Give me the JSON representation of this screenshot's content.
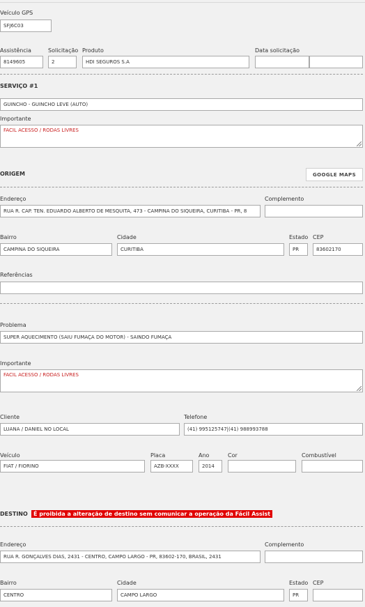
{
  "vehicle_gps": {
    "label": "Veículo GPS",
    "value": "SFJ6C03"
  },
  "request": {
    "assistencia": {
      "label": "Assistência",
      "value": "8149605"
    },
    "solicitacao": {
      "label": "Solicitação",
      "value": "2"
    },
    "produto": {
      "label": "Produto",
      "value": "HDI SEGUROS S.A"
    },
    "data_solicitacao": {
      "label": "Data solicitação",
      "value": "",
      "value2": ""
    }
  },
  "servico": {
    "title": "SERVIÇO #1",
    "value": "GUINCHO - GUINCHO LEVE (AUTO)",
    "importante_label": "Importante",
    "importante_value": "FACIL ACESSO / RODAS LIVRES"
  },
  "origem": {
    "title": "ORIGEM",
    "maps_button": "GOOGLE MAPS",
    "endereco_label": "Endereço",
    "endereco_value": "RUA R. CAP. TEN. EDUARDO ALBERTO DE MESQUITA, 473 - CAMPINA DO SIQUEIRA, CURITIBA - PR, 8",
    "complemento_label": "Complemento",
    "complemento_value": "",
    "bairro_label": "Bairro",
    "bairro_value": "CAMPINA DO SIQUEIRA",
    "cidade_label": "Cidade",
    "cidade_value": "CURITIBA",
    "estado_label": "Estado",
    "estado_value": "PR",
    "cep_label": "CEP",
    "cep_value": "83602170",
    "referencias_label": "Referências",
    "referencias_value": ""
  },
  "problema": {
    "label": "Problema",
    "value": "SUPER AQUECIMENTO (SAIU FUMAÇA DO MOTOR) - SAINDO FUMAÇA",
    "importante_label": "Importante",
    "importante_value": "FACIL ACESSO / RODAS LIVRES"
  },
  "cliente": {
    "label": "Cliente",
    "value": "LUANA / DANIEL NO LOCAL",
    "telefone_label": "Telefone",
    "telefone_value": "(41) 995125747|(41) 988993788"
  },
  "veiculo": {
    "label": "Veículo",
    "value": "FIAT / FIORINO",
    "placa_label": "Placa",
    "placa_value": "AZB-XXXX",
    "ano_label": "Ano",
    "ano_value": "2014",
    "cor_label": "Cor",
    "cor_value": "",
    "combustivel_label": "Combustível",
    "combustivel_value": ""
  },
  "destino": {
    "title": "DESTINO",
    "warning": "É proibida a alteração de destino sem comunicar a operação da Fácil Assist",
    "warning_color": "#e10000",
    "endereco_label": "Endereço",
    "endereco_value": "RUA R. GONÇALVES DIAS, 2431 - CENTRO, CAMPO LARGO - PR, 83602-170, BRASIL, 2431",
    "complemento_label": "Complemento",
    "complemento_value": "",
    "bairro_label": "Bairro",
    "bairro_value": "CENTRO",
    "cidade_label": "Cidade",
    "cidade_value": "CAMPO LARGO",
    "estado_label": "Estado",
    "estado_value": "PR",
    "cep_label": "CEP",
    "cep_value": ""
  }
}
